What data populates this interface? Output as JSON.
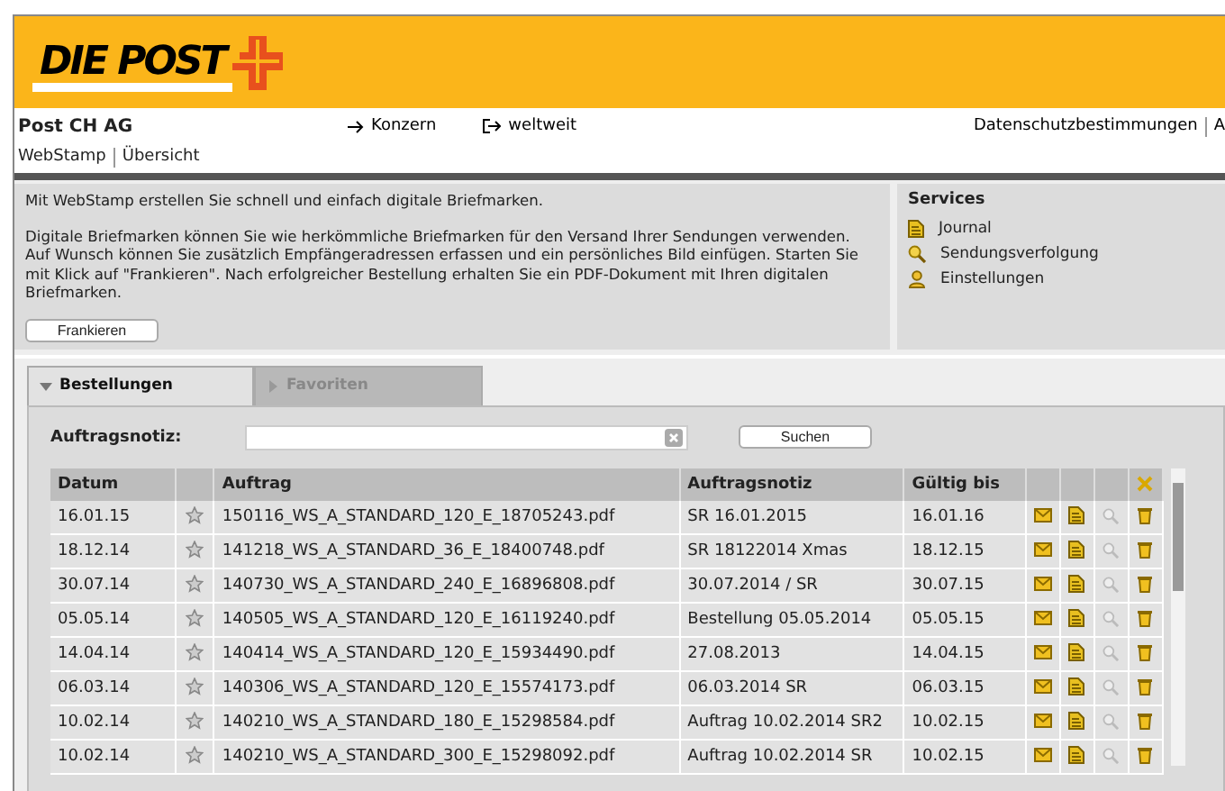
{
  "logo": {
    "text": "DIE POST"
  },
  "topbar": {
    "company": "Post CH AG",
    "links": [
      {
        "kind": "arrow",
        "label": "Konzern"
      },
      {
        "kind": "external",
        "label": "weltweit"
      }
    ],
    "right_links": [
      "Datenschutzbestimmungen",
      "A"
    ],
    "breadcrumb": [
      "WebStamp",
      "Übersicht"
    ]
  },
  "intro": {
    "lead": "Mit WebStamp erstellen Sie schnell und einfach digitale Briefmarken.",
    "body": "Digitale Briefmarken können Sie wie herkömmliche Briefmarken für den Versand Ihrer Sendungen verwenden. Auf Wunsch können Sie zusätzlich Empfängeradressen erfassen und ein persönliches Bild einfügen. Starten Sie mit Klick auf \"Frankieren\". Nach erfolgreicher Bestellung erhalten Sie ein PDF-Dokument mit Ihren digitalen Briefmarken.",
    "button": "Frankieren"
  },
  "services": {
    "title": "Services",
    "items": [
      {
        "kind": "journal",
        "label": "Journal"
      },
      {
        "kind": "tracking",
        "label": "Sendungsverfolgung"
      },
      {
        "kind": "settings",
        "label": "Einstellungen"
      }
    ]
  },
  "tabs": [
    {
      "label": "Bestellungen",
      "selected": true
    },
    {
      "label": "Favoriten",
      "selected": false
    }
  ],
  "search": {
    "label": "Auftragsnotiz:",
    "button": "Suchen"
  },
  "table": {
    "columns": [
      "Datum",
      "Auftrag",
      "Auftragsnotiz",
      "Gültig bis"
    ],
    "rows": [
      {
        "datum": "16.01.15",
        "auftrag": "150116_WS_A_STANDARD_120_E_18705243.pdf",
        "notiz": "SR 16.01.2015",
        "gueltig": "16.01.16"
      },
      {
        "datum": "18.12.14",
        "auftrag": "141218_WS_A_STANDARD_36_E_18400748.pdf",
        "notiz": "SR 18122014 Xmas",
        "gueltig": "18.12.15"
      },
      {
        "datum": "30.07.14",
        "auftrag": "140730_WS_A_STANDARD_240_E_16896808.pdf",
        "notiz": "30.07.2014 / SR",
        "gueltig": "30.07.15"
      },
      {
        "datum": "05.05.14",
        "auftrag": "140505_WS_A_STANDARD_120_E_16119240.pdf",
        "notiz": "Bestellung 05.05.2014",
        "gueltig": "05.05.15"
      },
      {
        "datum": "14.04.14",
        "auftrag": "140414_WS_A_STANDARD_120_E_15934490.pdf",
        "notiz": "27.08.2013",
        "gueltig": "14.04.15"
      },
      {
        "datum": "06.03.14",
        "auftrag": "140306_WS_A_STANDARD_120_E_15574173.pdf",
        "notiz": "06.03.2014 SR",
        "gueltig": "06.03.15"
      },
      {
        "datum": "10.02.14",
        "auftrag": "140210_WS_A_STANDARD_180_E_15298584.pdf",
        "notiz": "Auftrag 10.02.2014 SR2",
        "gueltig": "10.02.15"
      },
      {
        "datum": "10.02.14",
        "auftrag": "140210_WS_A_STANDARD_300_E_15298092.pdf",
        "notiz": "Auftrag 10.02.2014 SR",
        "gueltig": "10.02.15"
      }
    ]
  }
}
